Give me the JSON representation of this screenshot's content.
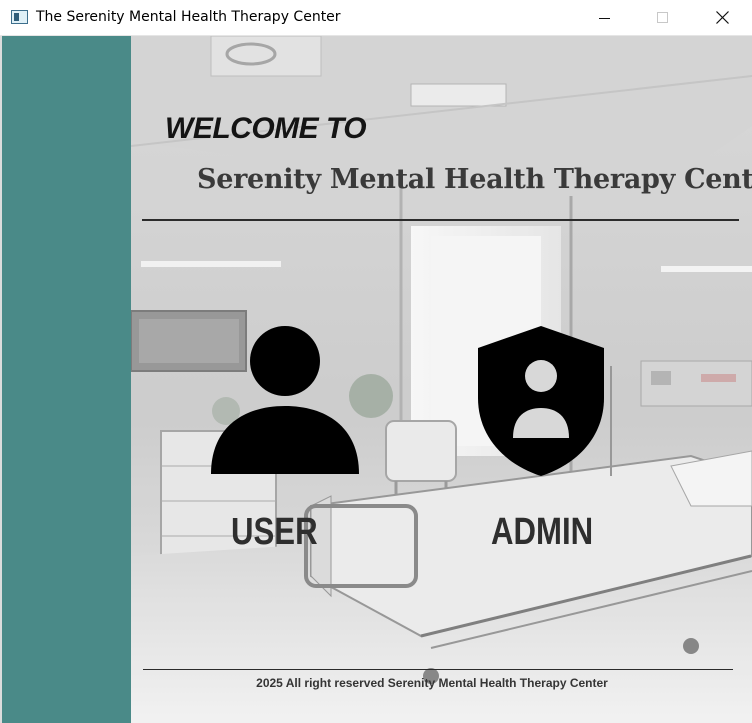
{
  "window": {
    "title": "The Serenity Mental Health Therapy Center"
  },
  "colors": {
    "sidebar": "#4a8a88",
    "heading": "#141414",
    "subheading": "#3a3a3a",
    "icon": "#000000"
  },
  "header": {
    "welcome": "WELCOME TO",
    "center_name": "Serenity Mental Health Therapy Center"
  },
  "roles": {
    "user": {
      "label": "USER",
      "icon": "person-icon"
    },
    "admin": {
      "label": "ADMIN",
      "icon": "shield-person-icon"
    }
  },
  "footer": {
    "text": "2025 All right reserved Serenity Mental Health Therapy Center"
  }
}
